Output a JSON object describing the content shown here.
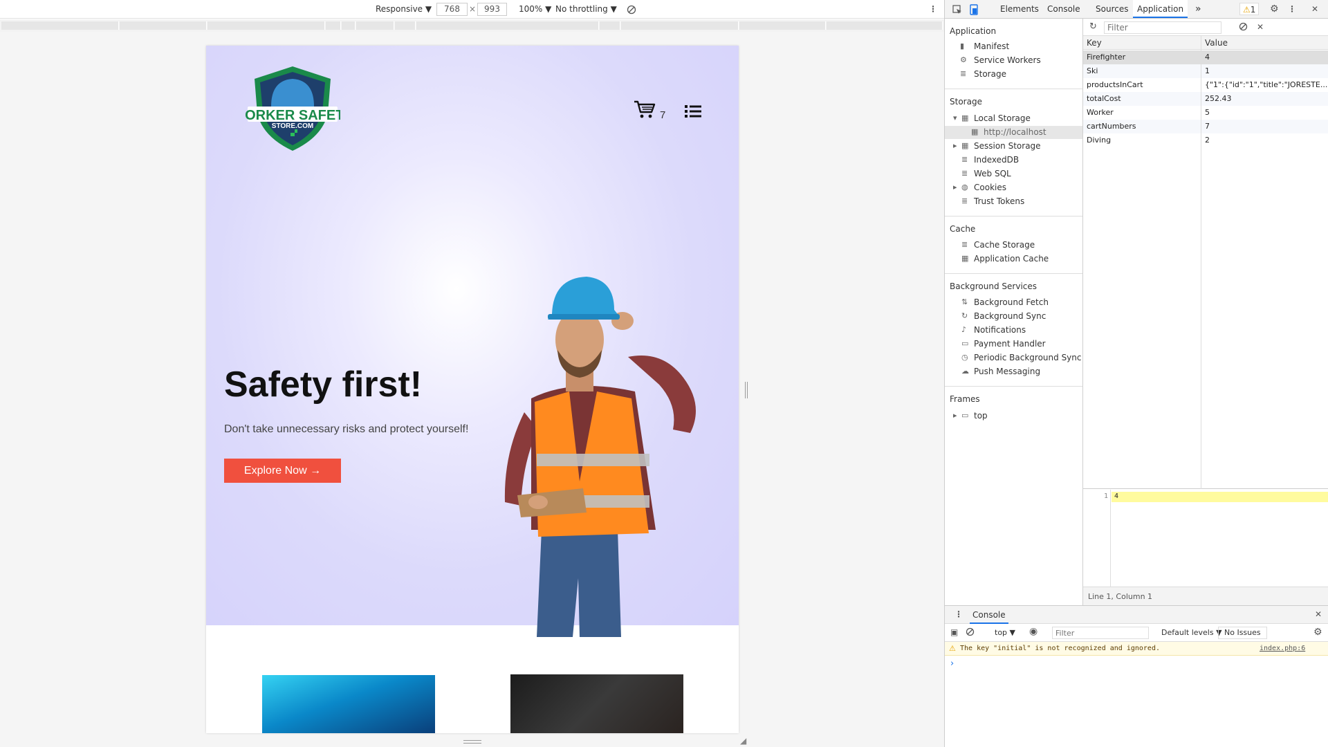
{
  "device_toolbar": {
    "device": "Responsive ▼",
    "width": "768",
    "times": "×",
    "height": "993",
    "zoom": "100% ▼",
    "throttle": "No throttling ▼"
  },
  "page": {
    "logo_text": "WORKER SAFETY",
    "logo_sub": "STORE.COM",
    "cart_count": "7",
    "hero_title": "Safety first!",
    "hero_sub": "Don't take unnecessary risks and protect yourself!",
    "cta": "Explore Now →"
  },
  "devtools": {
    "tabs": [
      "Elements",
      "Console",
      "Sources",
      "Application"
    ],
    "more": "»",
    "warnings": "1",
    "sidebar": {
      "application_header": "Application",
      "application_items": [
        "Manifest",
        "Service Workers",
        "Storage"
      ],
      "storage_header": "Storage",
      "storage_items": [
        "Local Storage",
        "http://localhost",
        "Session Storage",
        "IndexedDB",
        "Web SQL",
        "Cookies",
        "Trust Tokens"
      ],
      "cache_header": "Cache",
      "cache_items": [
        "Cache Storage",
        "Application Cache"
      ],
      "bg_header": "Background Services",
      "bg_items": [
        "Background Fetch",
        "Background Sync",
        "Notifications",
        "Payment Handler",
        "Periodic Background Sync",
        "Push Messaging"
      ],
      "frames_header": "Frames",
      "frames_items": [
        "top"
      ]
    },
    "filter_placeholder": "Filter",
    "table": {
      "col_key": "Key",
      "col_value": "Value",
      "rows": [
        {
          "key": "Firefighter",
          "value": "4"
        },
        {
          "key": "Ski",
          "value": "1"
        },
        {
          "key": "productsInCart",
          "value": "{\"1\":{\"id\":\"1\",\"title\":\"JORESTE..."
        },
        {
          "key": "totalCost",
          "value": "252.43"
        },
        {
          "key": "Worker",
          "value": "5"
        },
        {
          "key": "cartNumbers",
          "value": "7"
        },
        {
          "key": "Diving",
          "value": "2"
        }
      ]
    },
    "preview_line_no": "1",
    "preview_value": "4",
    "status": "Line 1, Column 1",
    "console": {
      "title": "Console",
      "context": "top ▼",
      "filter_placeholder": "Filter",
      "levels": "Default levels ▼",
      "issues": "No Issues",
      "warning_text": "The key \"initial\" is not recognized and ignored.",
      "warning_source": "index.php:6",
      "prompt": "›"
    }
  }
}
